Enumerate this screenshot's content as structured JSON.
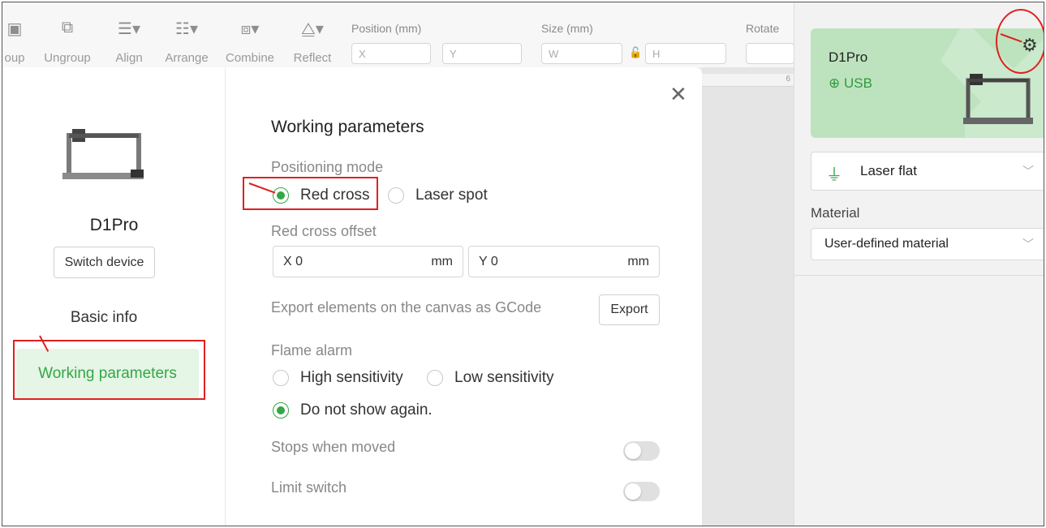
{
  "toolbar": {
    "tools": [
      {
        "label": "oup",
        "icon": "group-icon"
      },
      {
        "label": "Ungroup",
        "icon": "ungroup-icon"
      },
      {
        "label": "Align",
        "icon": "align-icon"
      },
      {
        "label": "Arrange",
        "icon": "arrange-icon"
      },
      {
        "label": "Combine",
        "icon": "combine-icon"
      },
      {
        "label": "Reflect",
        "icon": "reflect-icon"
      }
    ],
    "position_label": "Position (mm)",
    "x_placeholder": "X",
    "y_placeholder": "Y",
    "size_label": "Size (mm)",
    "w_placeholder": "W",
    "h_placeholder": "H",
    "rotate_label": "Rotate"
  },
  "canvas": {
    "ruler_number": "6"
  },
  "right_panel": {
    "device_name": "D1Pro",
    "connection": "USB",
    "mode": "Laser flat",
    "material_label": "Material",
    "material_value": "User-defined material"
  },
  "sidebar": {
    "device_name": "D1Pro",
    "switch_device": "Switch device",
    "basic_info": "Basic info",
    "working_parameters": "Working parameters"
  },
  "content": {
    "title": "Working parameters",
    "positioning_mode_label": "Positioning mode",
    "red_cross": "Red cross",
    "laser_spot": "Laser spot",
    "red_cross_offset_label": "Red cross offset",
    "offset_x": "X 0",
    "offset_y": "Y 0",
    "unit": "mm",
    "export_label": "Export elements on the canvas as GCode",
    "export_button": "Export",
    "flame_alarm_label": "Flame alarm",
    "high_sensitivity": "High sensitivity",
    "low_sensitivity": "Low sensitivity",
    "do_not_show": "Do not show again.",
    "stops_when_moved": "Stops when moved",
    "limit_switch": "Limit switch"
  },
  "colors": {
    "accent": "#34a745",
    "highlight": "#e02020",
    "card": "#bde3be"
  }
}
